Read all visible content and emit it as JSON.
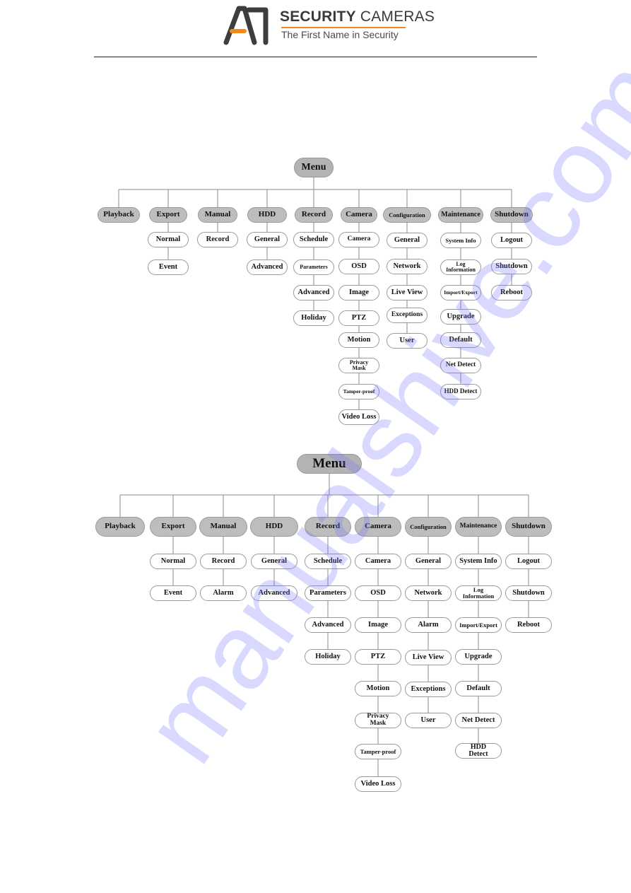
{
  "header": {
    "brand_bold": "SECURITY",
    "brand_light": "CAMERAS",
    "tagline": "The First Name in Security",
    "logo_icon": "a1-logo-icon",
    "accent_color": "#f08a1c"
  },
  "watermark": "manualshive.com",
  "diagrams": [
    {
      "root": "Menu",
      "columns": [
        {
          "label": "Playback",
          "children": []
        },
        {
          "label": "Export",
          "children": [
            "Normal",
            "Event"
          ]
        },
        {
          "label": "Manual",
          "children": [
            "Record"
          ]
        },
        {
          "label": "HDD",
          "children": [
            "General",
            "Advanced"
          ]
        },
        {
          "label": "Record",
          "children": [
            "Schedule",
            "Parameters",
            "Advanced",
            "Holiday"
          ]
        },
        {
          "label": "Camera",
          "children": [
            "Camera",
            "OSD",
            "Image",
            "PTZ",
            "Motion",
            "Privacy\nMask",
            "Tamper-proof",
            "Video Loss"
          ]
        },
        {
          "label": "Configuration",
          "children": [
            "General",
            "Network",
            "Live View",
            "Exceptions",
            "User"
          ]
        },
        {
          "label": "Maintenance",
          "children": [
            "System Info",
            "Log\nInformation",
            "Import/Export",
            "Upgrade",
            "Default",
            "Net Detect",
            "HDD Detect"
          ]
        },
        {
          "label": "Shutdown",
          "children": [
            "Logout",
            "Shutdown",
            "Reboot"
          ]
        }
      ]
    },
    {
      "root": "Menu",
      "columns": [
        {
          "label": "Playback",
          "children": []
        },
        {
          "label": "Export",
          "children": [
            "Normal",
            "Event"
          ]
        },
        {
          "label": "Manual",
          "children": [
            "Record",
            "Alarm"
          ]
        },
        {
          "label": "HDD",
          "children": [
            "General",
            "Advanced"
          ]
        },
        {
          "label": "Record",
          "children": [
            "Schedule",
            "Parameters",
            "Advanced",
            "Holiday"
          ]
        },
        {
          "label": "Camera",
          "children": [
            "Camera",
            "OSD",
            "Image",
            "PTZ",
            "Motion",
            "Privacy\nMask",
            "Tamper-proof",
            "Video Loss"
          ]
        },
        {
          "label": "Configuration",
          "children": [
            "General",
            "Network",
            "Alarm",
            "Live View",
            "Exceptions",
            "User"
          ]
        },
        {
          "label": "Maintenance",
          "children": [
            "System Info",
            "Log\nInformation",
            "Import/Export",
            "Upgrade",
            "Default",
            "Net Detect",
            "HDD\nDetect"
          ]
        },
        {
          "label": "Shutdown",
          "children": [
            "Logout",
            "Shutdown",
            "Reboot"
          ]
        }
      ]
    }
  ]
}
